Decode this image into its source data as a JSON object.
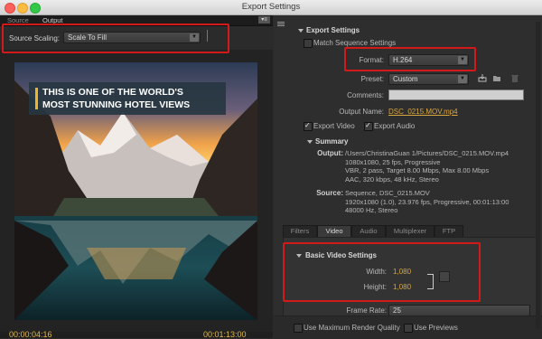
{
  "window": {
    "title": "Export Settings"
  },
  "source_panel": {
    "tabs": [
      {
        "label": "Source"
      },
      {
        "label": "Output"
      }
    ],
    "source_scaling": {
      "label": "Source Scaling:",
      "value": "Scale To Fill"
    },
    "preview": {
      "overlay_line1": "THIS IS ONE OF THE WORLD'S",
      "overlay_line2": "MOST STUNNING HOTEL VIEWS"
    },
    "timecode_left": "00:00:04:16",
    "timecode_right": "00:01:13:00"
  },
  "export_settings": {
    "header": "Export Settings",
    "match_sequence": {
      "label": "Match Sequence Settings",
      "checked": false
    },
    "format": {
      "label": "Format:",
      "value": "H.264"
    },
    "preset": {
      "label": "Preset:",
      "value": "Custom"
    },
    "comments": {
      "label": "Comments:",
      "value": ""
    },
    "output_name": {
      "label": "Output Name:",
      "value": "DSC_0215.MOV.mp4"
    },
    "export_video": {
      "label": "Export Video",
      "checked": true
    },
    "export_audio": {
      "label": "Export Audio",
      "checked": true
    },
    "summary": {
      "header": "Summary",
      "output_label": "Output:",
      "output_lines": [
        "/Users/ChristinaGuan 1/Pictures/DSC_0215.MOV.mp4",
        "1080x1080, 25 fps, Progressive",
        "VBR, 2 pass, Target 8.00 Mbps, Max 8.00 Mbps",
        "AAC, 320 kbps, 48 kHz, Stereo"
      ],
      "source_label": "Source:",
      "source_lines": [
        "Sequence, DSC_0215.MOV",
        "1920x1080 (1.0), 23.976 fps, Progressive, 00:01:13:00",
        "48000 Hz, Stereo"
      ]
    }
  },
  "tabs": [
    {
      "label": "Filters"
    },
    {
      "label": "Video"
    },
    {
      "label": "Audio"
    },
    {
      "label": "Multiplexer"
    },
    {
      "label": "FTP"
    }
  ],
  "basic_video": {
    "header": "Basic Video Settings",
    "width": {
      "label": "Width:",
      "value": "1,080"
    },
    "height": {
      "label": "Height:",
      "value": "1,080"
    },
    "frame_rate": {
      "label": "Frame Rate:",
      "value": "25"
    }
  },
  "bottom": {
    "max_render_quality": {
      "label": "Use Maximum Render Quality",
      "checked": false
    },
    "use_previews": {
      "label": "Use Previews",
      "checked": false
    }
  },
  "colors": {
    "accent": "#d9a63e",
    "highlight_box": "#d21a1a",
    "banner_bar": "#f0b428"
  }
}
